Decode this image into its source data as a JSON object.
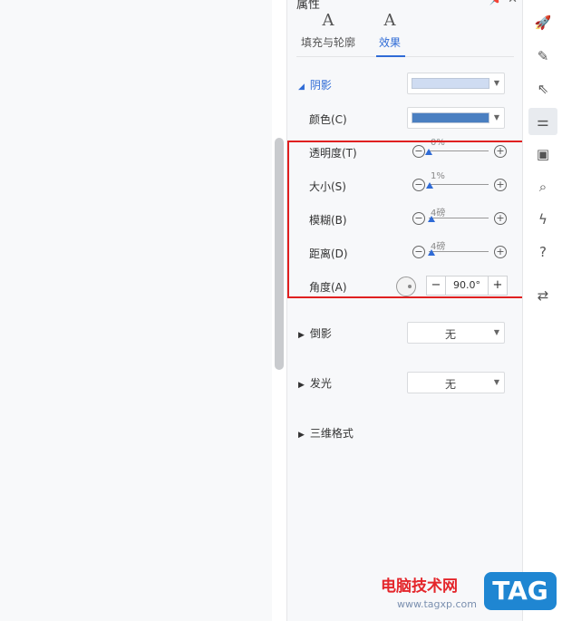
{
  "panel": {
    "title": "属性",
    "header_icons": "📌 ✕",
    "tabs": [
      {
        "label": "填充与轮廓",
        "icon": "A"
      },
      {
        "label": "效果",
        "icon": "A"
      }
    ]
  },
  "shadow": {
    "label": "阴影",
    "color_label": "颜色(C)",
    "preset_swatch": "#cfdcf2",
    "color_swatch": "#4a7fc1",
    "transparency": {
      "label": "透明度(T)",
      "value": "0%",
      "fraction": 0.0
    },
    "size": {
      "label": "大小(S)",
      "value": "1%",
      "fraction": 0.01
    },
    "blur": {
      "label": "模糊(B)",
      "value": "4磅",
      "fraction": 0.04
    },
    "distance": {
      "label": "距离(D)",
      "value": "4磅",
      "fraction": 0.04
    },
    "angle": {
      "label": "角度(A)",
      "value": "90.0°"
    }
  },
  "reflection": {
    "label": "倒影",
    "value": "无"
  },
  "glow": {
    "label": "发光",
    "value": "无"
  },
  "three_d": {
    "label": "三维格式"
  },
  "sidebar_icons": [
    "rocket-icon",
    "pen-icon",
    "cursor-icon",
    "sliders-icon",
    "image-edit-icon",
    "book-search-icon",
    "lightning-icon",
    "help-icon",
    "transfer-icon"
  ],
  "watermark": {
    "text": "电脑技术网",
    "url": "www.tagxp.com",
    "badge": "TAG"
  }
}
